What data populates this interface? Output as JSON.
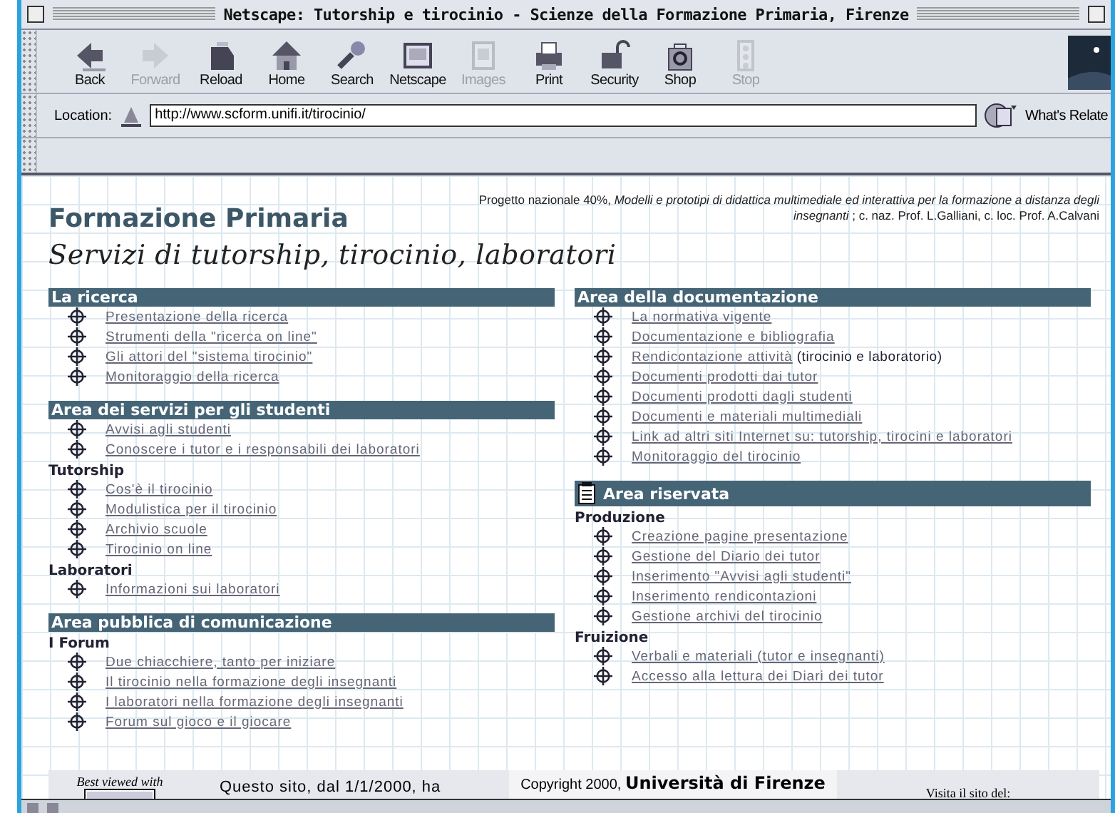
{
  "window": {
    "title": "Netscape: Tutorship e tirocinio - Scienze della Formazione Primaria, Firenze"
  },
  "toolbar": [
    {
      "label": "Back",
      "disabled": false
    },
    {
      "label": "Forward",
      "disabled": true
    },
    {
      "label": "Reload",
      "disabled": false
    },
    {
      "label": "Home",
      "disabled": false
    },
    {
      "label": "Search",
      "disabled": false
    },
    {
      "label": "Netscape",
      "disabled": false
    },
    {
      "label": "Images",
      "disabled": true
    },
    {
      "label": "Print",
      "disabled": false
    },
    {
      "label": "Security",
      "disabled": false
    },
    {
      "label": "Shop",
      "disabled": false
    },
    {
      "label": "Stop",
      "disabled": true
    }
  ],
  "location": {
    "label": "Location:",
    "url": "http://www.scform.unifi.it/tirocinio/",
    "related": "What's Relate"
  },
  "header": {
    "title": "Formazione Primaria",
    "subtitle": "Servizi di tutorship, tirocinio, laboratori",
    "note": "Progetto nazionale 40%, *Modelli e prototipi di didattica multimediale ed interattiva per la formazione a distanza degli insegnanti* ; c. naz. Prof. L.Galliani, c. loc. Prof. A.Calvani"
  },
  "columns": [
    [
      {
        "heading": "La ricerca",
        "locked": false,
        "groups": [
          {
            "items": [
              {
                "text": "Presentazione della ricerca"
              },
              {
                "text": "Strumenti della \"ricerca on line\""
              },
              {
                "text": "Gli attori del \"sistema tirocinio\""
              },
              {
                "text": "Monitoraggio della ricerca"
              }
            ]
          }
        ]
      },
      {
        "heading": "Area dei servizi per gli studenti",
        "locked": false,
        "groups": [
          {
            "items": [
              {
                "text": "Avvisi agli studenti"
              },
              {
                "text": "Conoscere i tutor e i responsabili dei laboratori"
              }
            ]
          },
          {
            "label": "Tutorship",
            "items": [
              {
                "text": "Cos'è il tirocinio"
              },
              {
                "text": "Modulistica per il tirocinio"
              },
              {
                "text": "Archivio scuole"
              },
              {
                "text": "Tirocinio on line"
              }
            ]
          },
          {
            "label": "Laboratori",
            "items": [
              {
                "text": "Informazioni sui laboratori"
              }
            ]
          }
        ]
      },
      {
        "heading": "Area pubblica di comunicazione",
        "locked": false,
        "groups": [
          {
            "label": "I Forum",
            "items": [
              {
                "text": "Due chiacchiere, tanto per iniziare"
              },
              {
                "text": "Il  tirocinio nella formazione degli insegnanti"
              },
              {
                "text": "I laboratori nella formazione degli insegnanti"
              },
              {
                "text": "Forum sul gioco e il giocare"
              }
            ]
          }
        ]
      }
    ],
    [
      {
        "heading": "Area della documentazione",
        "locked": false,
        "groups": [
          {
            "items": [
              {
                "text": "La normativa vigente"
              },
              {
                "text": "Documentazione e bibliografia"
              },
              {
                "text": "Rendicontazione attività",
                "note": "(tirocinio e laboratorio)"
              },
              {
                "text": "Documenti prodotti dai tutor"
              },
              {
                "text": "Documenti prodotti dagli studenti"
              },
              {
                "text": "Documenti e materiali multimediali"
              },
              {
                "text": "Link ad altri siti Internet su: tutorship, tirocini e laboratori"
              },
              {
                "text": "Monitoraggio del tirocinio"
              }
            ]
          }
        ]
      },
      {
        "heading": "Area riservata",
        "locked": true,
        "groups": [
          {
            "label": "Produzione",
            "items": [
              {
                "text": "Creazione pagine presentazione"
              },
              {
                "text": "Gestione del Diario dei tutor"
              },
              {
                "text": "Inserimento \"Avvisi agli studenti\""
              },
              {
                "text": "Inserimento rendicontazioni"
              },
              {
                "text": "Gestione archivi del tirocinio"
              }
            ]
          },
          {
            "label": "Fruizione",
            "items": [
              {
                "text": "Verbali e materiali (tutor e insegnanti)"
              },
              {
                "text": "Accesso alla lettura dei Diari dei tutor"
              }
            ]
          }
        ]
      }
    ]
  ],
  "footer": {
    "best_viewed": "Best viewed with",
    "counter": "Questo sito, dal 1/1/2000, ha",
    "copyright": "Copyright 2000, **Università di Firenze**",
    "visit": "Visita il sito del:"
  }
}
